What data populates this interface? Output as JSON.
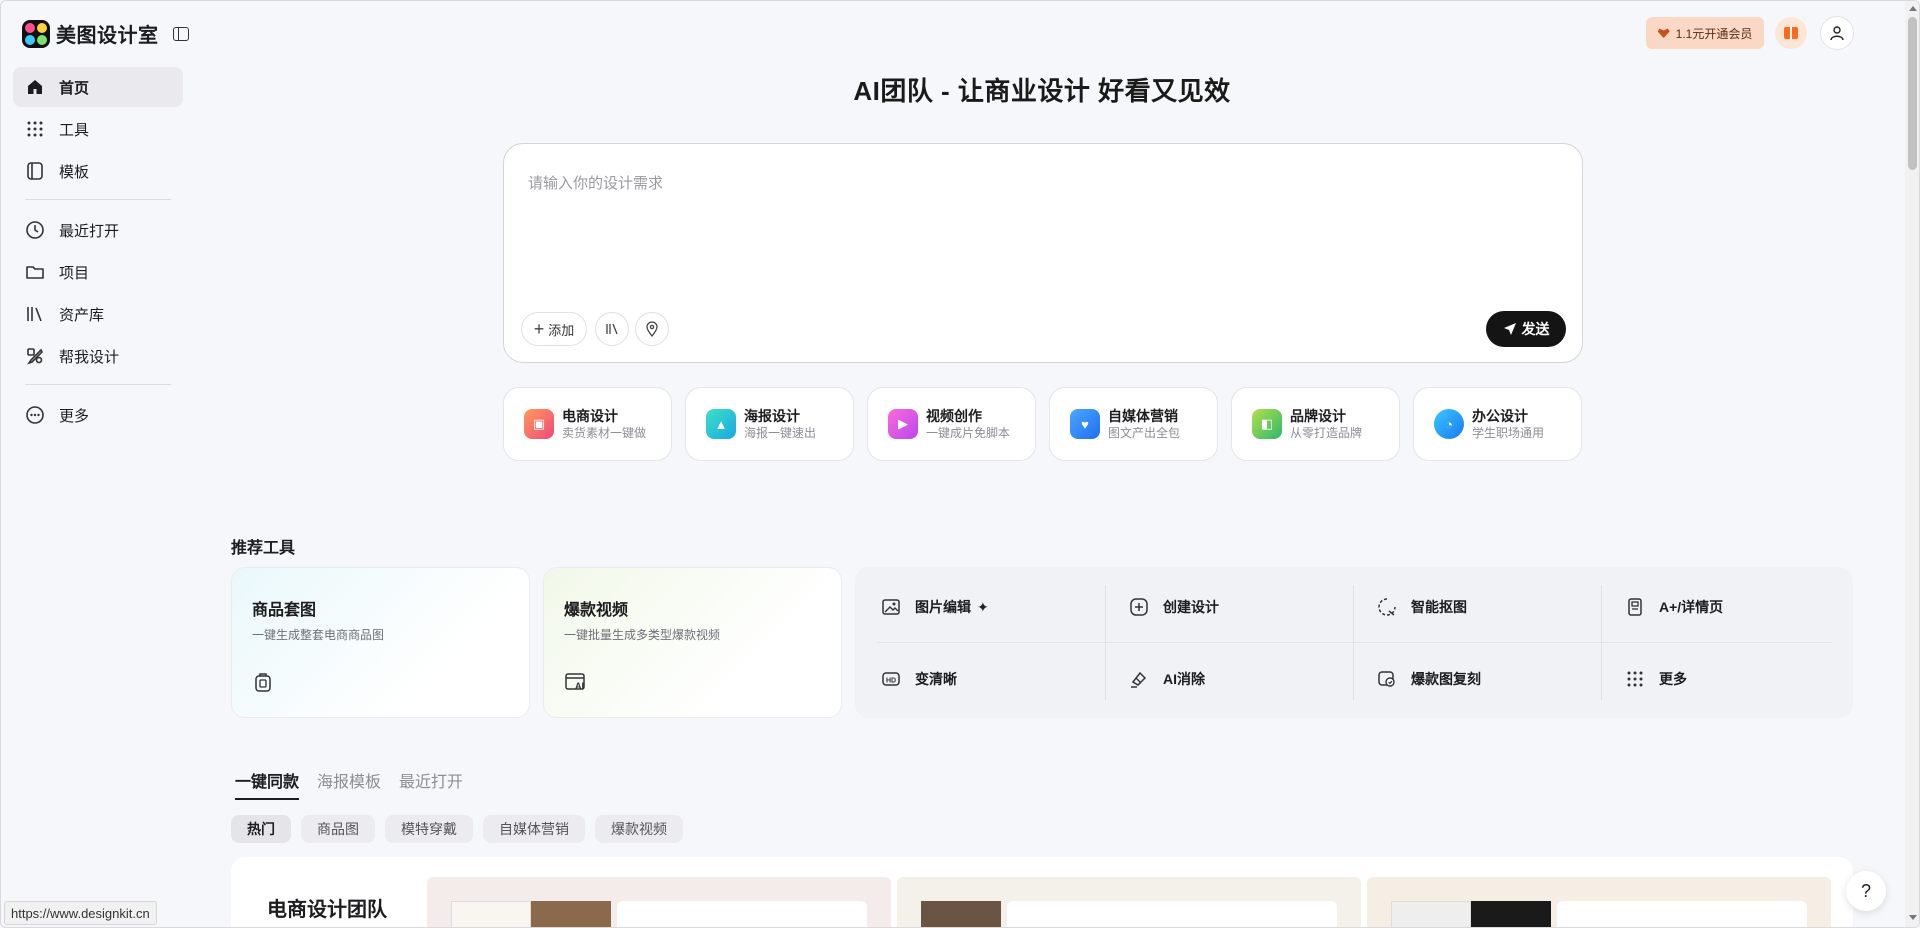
{
  "brand": {
    "name": "美图设计室"
  },
  "nav": {
    "primary": [
      {
        "label": "首页",
        "icon": "home-icon",
        "active": true
      },
      {
        "label": "工具",
        "icon": "grid-icon"
      },
      {
        "label": "模板",
        "icon": "template-icon"
      }
    ],
    "secondary": [
      {
        "label": "最近打开",
        "icon": "clock-icon"
      },
      {
        "label": "项目",
        "icon": "folder-icon"
      },
      {
        "label": "资产库",
        "icon": "library-icon"
      },
      {
        "label": "帮我设计",
        "icon": "design-help-icon"
      }
    ],
    "more": {
      "label": "更多",
      "icon": "more-icon"
    }
  },
  "topbar": {
    "vip_label": "1.1元开通会员"
  },
  "hero": {
    "title": "AI团队 - 让商业设计 好看又见效",
    "placeholder": "请输入你的设计需求",
    "add_label": "添加",
    "send_label": "发送"
  },
  "categories": [
    {
      "title": "电商设计",
      "sub": "卖货素材一键做",
      "color": "#f05a7a"
    },
    {
      "title": "海报设计",
      "sub": "海报一键速出",
      "color": "#18b8d6"
    },
    {
      "title": "视频创作",
      "sub": "一键成片免脚本",
      "color": "#d94ae0"
    },
    {
      "title": "自媒体营销",
      "sub": "图文产出全包",
      "color": "#2f86f6"
    },
    {
      "title": "品牌设计",
      "sub": "从零打造品牌",
      "color": "#42c25c"
    },
    {
      "title": "办公设计",
      "sub": "学生职场通用",
      "color": "#1e9bf0"
    }
  ],
  "recommended": {
    "title": "推荐工具",
    "cards": [
      {
        "title": "商品套图",
        "sub": "一键生成整套电商商品图"
      },
      {
        "title": "爆款视频",
        "sub": "一键批量生成多类型爆款视频"
      }
    ],
    "tools": [
      {
        "label": "图片编辑",
        "icon": "image-edit-icon"
      },
      {
        "label": "创建设计",
        "icon": "plus-square-icon"
      },
      {
        "label": "智能抠图",
        "icon": "cutout-icon"
      },
      {
        "label": "A+/详情页",
        "icon": "detail-page-icon"
      },
      {
        "label": "变清晰",
        "icon": "hd-icon"
      },
      {
        "label": "AI消除",
        "icon": "eraser-icon"
      },
      {
        "label": "爆款图复刻",
        "icon": "replicate-icon"
      },
      {
        "label": "更多",
        "icon": "grid-more-icon"
      }
    ]
  },
  "tabs": [
    "一键同款",
    "海报模板",
    "最近打开"
  ],
  "chips": [
    "热门",
    "商品图",
    "模特穿戴",
    "自媒体营销",
    "爆款视频"
  ],
  "bottom": {
    "title": "电商设计团队"
  },
  "status_url": "https://www.designkit.cn",
  "help_label": "?"
}
